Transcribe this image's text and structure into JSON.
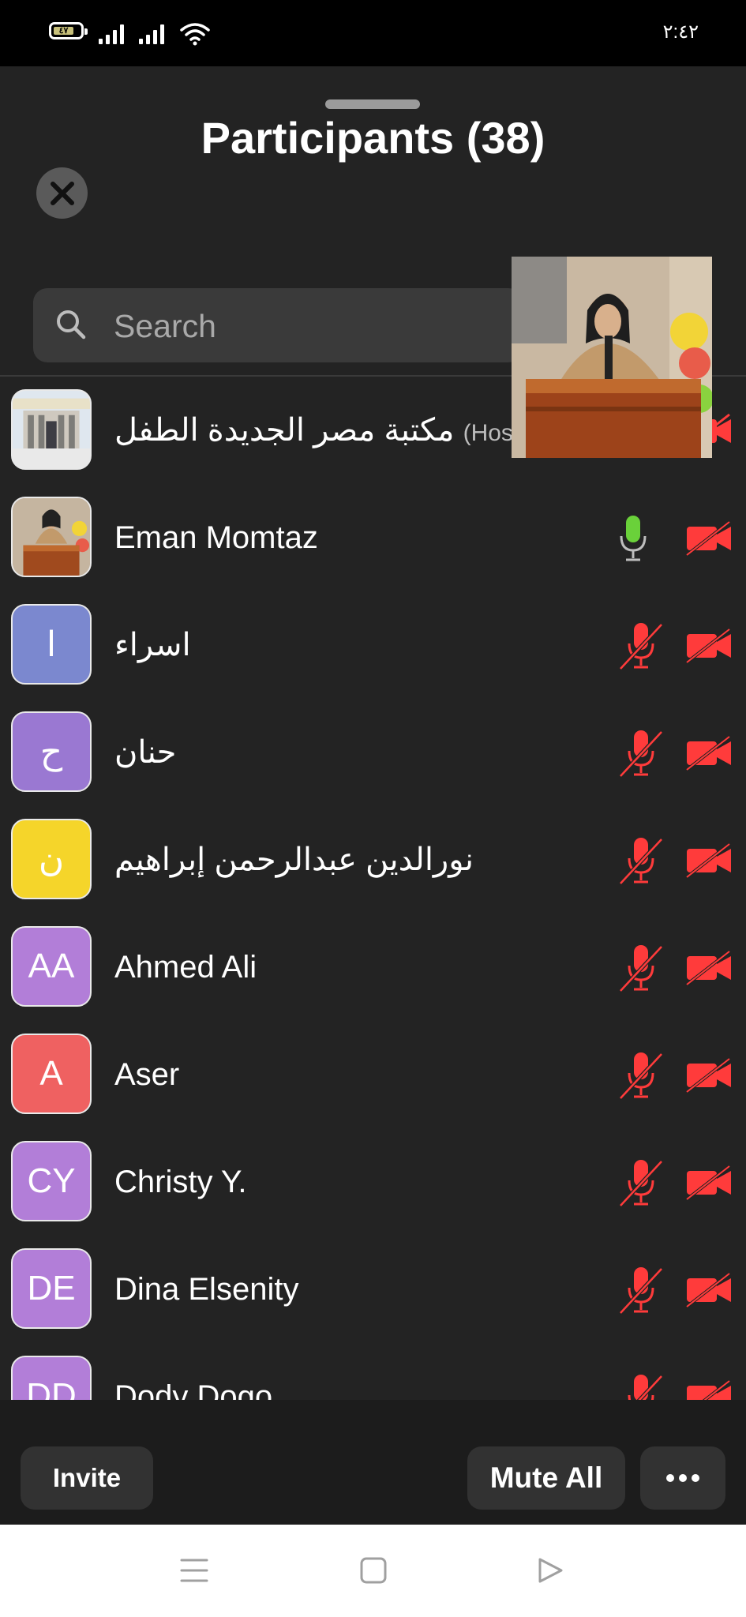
{
  "status_bar": {
    "battery_level": "٤٧",
    "time": "٢:٤٢"
  },
  "sheet": {
    "title": "Participants (38)"
  },
  "search": {
    "placeholder": "Search"
  },
  "participants": [
    {
      "name": "مكتبة مصر الجديدة الطفل",
      "role": "(Host, r",
      "avatar_type": "photo-building",
      "mic": "muted-red",
      "camera": "off-red"
    },
    {
      "name": "Eman Momtaz",
      "role": "",
      "avatar_type": "photo-speaker",
      "mic": "on-green",
      "camera": "off-red"
    },
    {
      "name": "اسراء",
      "role": "",
      "initials": "ا",
      "avatar_color": "#7b88cf",
      "mic": "muted-red",
      "camera": "off-red"
    },
    {
      "name": "حنان",
      "role": "",
      "initials": "ح",
      "avatar_color": "#9a78d2",
      "mic": "muted-red",
      "camera": "off-red"
    },
    {
      "name": "نورالدين عبدالرحمن إبراهيم",
      "role": "",
      "initials": "ن",
      "avatar_color": "#f5d52a",
      "mic": "muted-red",
      "camera": "off-red"
    },
    {
      "name": "Ahmed Ali",
      "role": "",
      "initials": "AA",
      "avatar_color": "#b27ed8",
      "mic": "muted-red",
      "camera": "off-red"
    },
    {
      "name": "Aser",
      "role": "",
      "initials": "A",
      "avatar_color": "#ef6161",
      "mic": "muted-red",
      "camera": "off-red"
    },
    {
      "name": "Christy Y.",
      "role": "",
      "initials": "CY",
      "avatar_color": "#b27ed8",
      "mic": "muted-red",
      "camera": "off-red"
    },
    {
      "name": "Dina Elsenity",
      "role": "",
      "initials": "DE",
      "avatar_color": "#b27ed8",
      "mic": "muted-red",
      "camera": "off-red"
    },
    {
      "name": "Dody Dogo",
      "role": "",
      "initials": "DD",
      "avatar_color": "#b27ed8",
      "mic": "muted-red",
      "camera": "off-red"
    }
  ],
  "bottom_bar": {
    "invite_label": "Invite",
    "mute_all_label": "Mute All"
  },
  "colors": {
    "background": "#232323",
    "muted_red": "#ff3b3b",
    "mic_on_green": "#6ad13a"
  }
}
